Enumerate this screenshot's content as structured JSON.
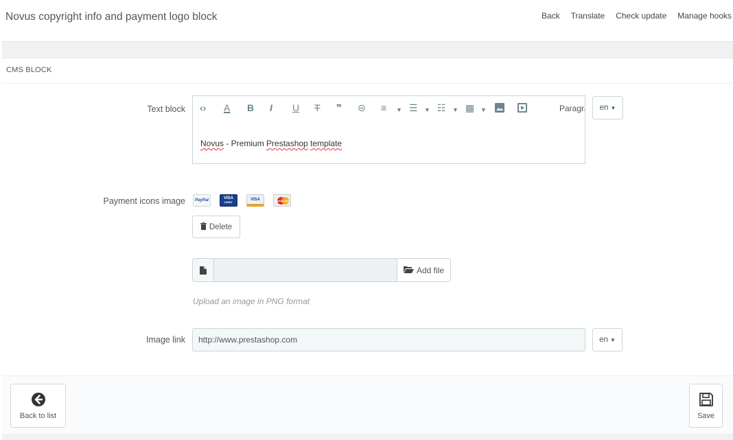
{
  "header": {
    "title": "Novus copyright info and payment logo block",
    "links": [
      "Back",
      "Translate",
      "Check update",
      "Manage hooks"
    ]
  },
  "panel": {
    "heading": "CMS BLOCK"
  },
  "text_block": {
    "label": "Text block",
    "paragraph_label": "Paragrap",
    "content_word1": "Novus",
    "content_sep": " - Premium ",
    "content_word2": "Prestashop",
    "content_word3": "template",
    "lang": "en",
    "toolbar_icons": [
      "code-icon",
      "font-color-icon",
      "bold-icon",
      "italic-icon",
      "underline-icon",
      "strikethrough-icon",
      "blockquote-icon",
      "link-icon",
      "align-icon",
      "bullet-list-icon",
      "numbered-list-icon",
      "table-icon",
      "image-icon",
      "media-icon"
    ]
  },
  "payment": {
    "label": "Payment icons image",
    "icons": {
      "paypal": "PayPal",
      "visa_debit_top": "VISA",
      "visa_debit_bottom": "DEBIT",
      "visa": "VISA",
      "mastercard": "mastercard"
    },
    "delete_label": "Delete",
    "add_file_label": "Add file",
    "file_value": "",
    "help": "Upload an image in PNG format"
  },
  "image_link": {
    "label": "Image link",
    "value": "http://www.prestashop.com",
    "lang": "en"
  },
  "footer": {
    "back_label": "Back to list",
    "save_label": "Save"
  },
  "colors": {
    "accent": "#25b9d7",
    "icon": "#6c868e",
    "border": "#c7d6db"
  }
}
